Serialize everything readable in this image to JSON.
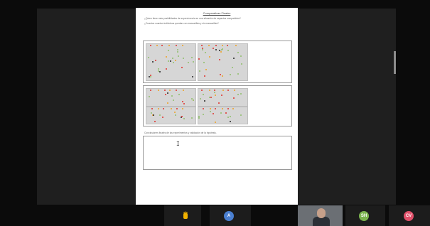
{
  "document": {
    "title": "Comparativas Finales",
    "question_1": "¿Quien tiene más posibilidades de supervivencia en una situación de espacios compartidos?",
    "question_2": "¿Cuantos cuantos individuos quedan con mascarillas y sin mascarillas?",
    "conclusions_label": "Conclusiones finales de las experimentos y validación de la hipótesis."
  },
  "colors": {
    "simulation_background": "#d6d6d6",
    "agent_green": "#8fbf6a",
    "agent_red": "#e0302a",
    "agent_orange": "#f0a020",
    "agent_black": "#222222"
  },
  "participants": [
    {
      "icon": "raised-hand-icon",
      "initials": "",
      "label": "",
      "color": "#f2b200"
    },
    {
      "icon": "avatar-icon",
      "initials": "A",
      "label": "",
      "color": "#4a7fd0"
    },
    {
      "icon": "camera-video-icon",
      "initials": "",
      "label": "",
      "color": ""
    },
    {
      "icon": "avatar-icon",
      "initials": "SH",
      "label": "",
      "color": "#7bb34e"
    },
    {
      "icon": "avatar-icon",
      "initials": "CV",
      "label": "",
      "color": "#e0506a"
    }
  ],
  "cursor_glyph": "I"
}
